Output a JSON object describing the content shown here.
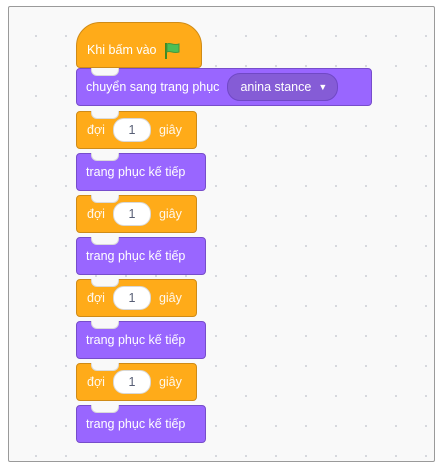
{
  "hat": {
    "label": "Khi bấm vào",
    "flag_icon": "green-flag-icon",
    "color": "#FFAB19"
  },
  "switch_costume": {
    "label": "chuyển sang trang phục",
    "costume": "anina stance",
    "color": "#9966FF"
  },
  "wait_blocks": [
    {
      "label": "đợi",
      "value": "1",
      "unit": "giây"
    },
    {
      "label": "đợi",
      "value": "1",
      "unit": "giây"
    },
    {
      "label": "đợi",
      "value": "1",
      "unit": "giây"
    },
    {
      "label": "đợi",
      "value": "1",
      "unit": "giây"
    }
  ],
  "next_costume_blocks": [
    {
      "label": "trang phục kế tiếp"
    },
    {
      "label": "trang phục kế tiếp"
    },
    {
      "label": "trang phục kế tiếp"
    },
    {
      "label": "trang phục kế tiếp"
    }
  ]
}
